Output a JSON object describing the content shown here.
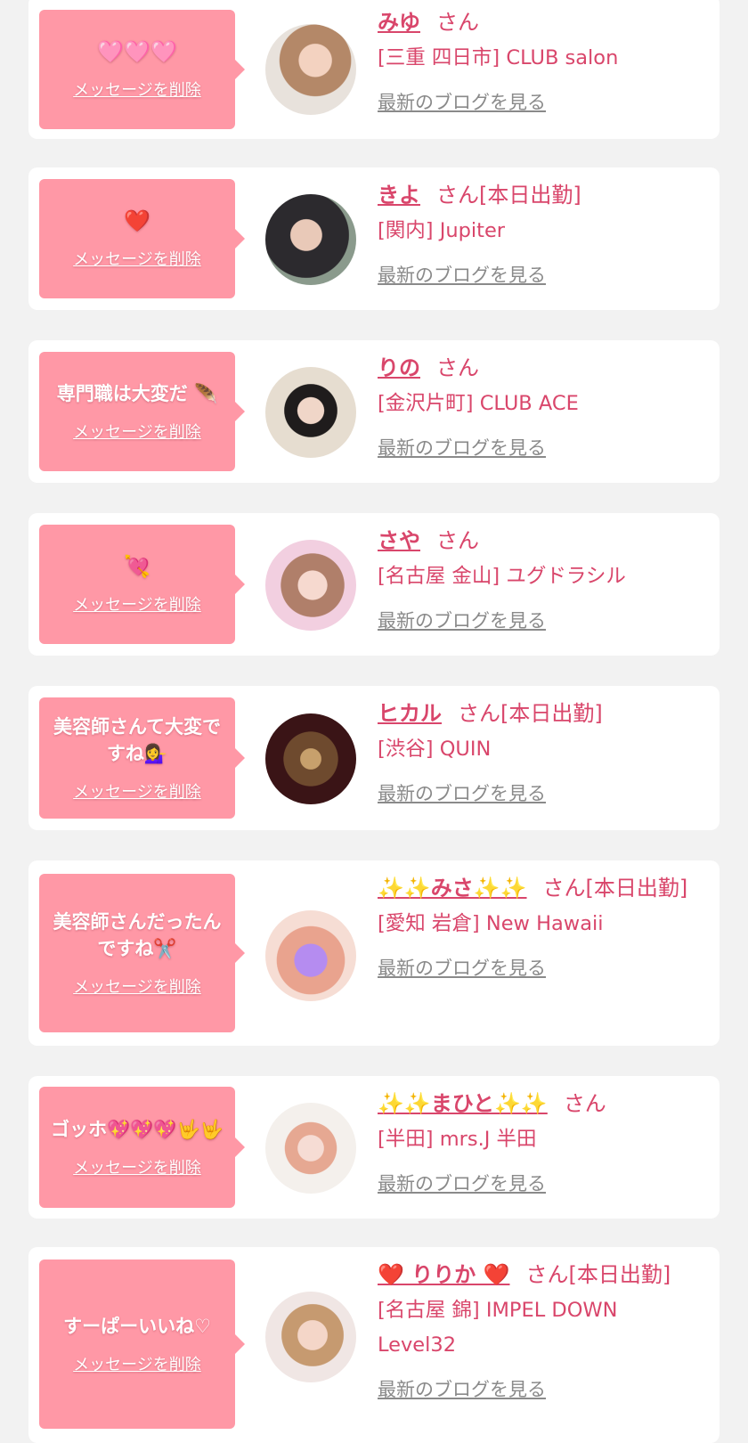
{
  "delete_label": "メッセージを削除",
  "blog_label": "最新のブログを見る",
  "entries": [
    {
      "message": "🩷🩷🩷",
      "name": "みゆ",
      "suffix": "さん",
      "shop": "[三重 四日市] CLUB salon"
    },
    {
      "message": "❤️",
      "name": "きよ",
      "suffix": "さん[本日出勤]",
      "shop": "[関内] Jupiter"
    },
    {
      "message": "専門職は大変だ 🪶",
      "name": "りの",
      "suffix": "さん",
      "shop": "[金沢片町] CLUB ACE"
    },
    {
      "message": "💘",
      "name": "さや",
      "suffix": "さん",
      "shop": "[名古屋 金山] ユグドラシル"
    },
    {
      "message": "美容師さんて大変ですね💁‍♀️",
      "name": "ヒカル",
      "suffix": "さん[本日出勤]",
      "shop": "[渋谷] QUIN"
    },
    {
      "message": "美容師さんだったんですね✂️",
      "name": "✨✨みさ✨✨",
      "suffix": "さん[本日出勤]",
      "shop": "[愛知 岩倉] New Hawaii"
    },
    {
      "message": "ゴッホ💖💖💖🤟🤟",
      "name": "✨✨まひと✨✨",
      "suffix": "さん",
      "shop": "[半田] mrs.J 半田"
    },
    {
      "message": "すーぱーいいね♡",
      "name": "❤️ りりか ❤️",
      "suffix": "さん[本日出勤]",
      "shop": "[名古屋 錦] IMPEL DOWN Level32"
    }
  ]
}
